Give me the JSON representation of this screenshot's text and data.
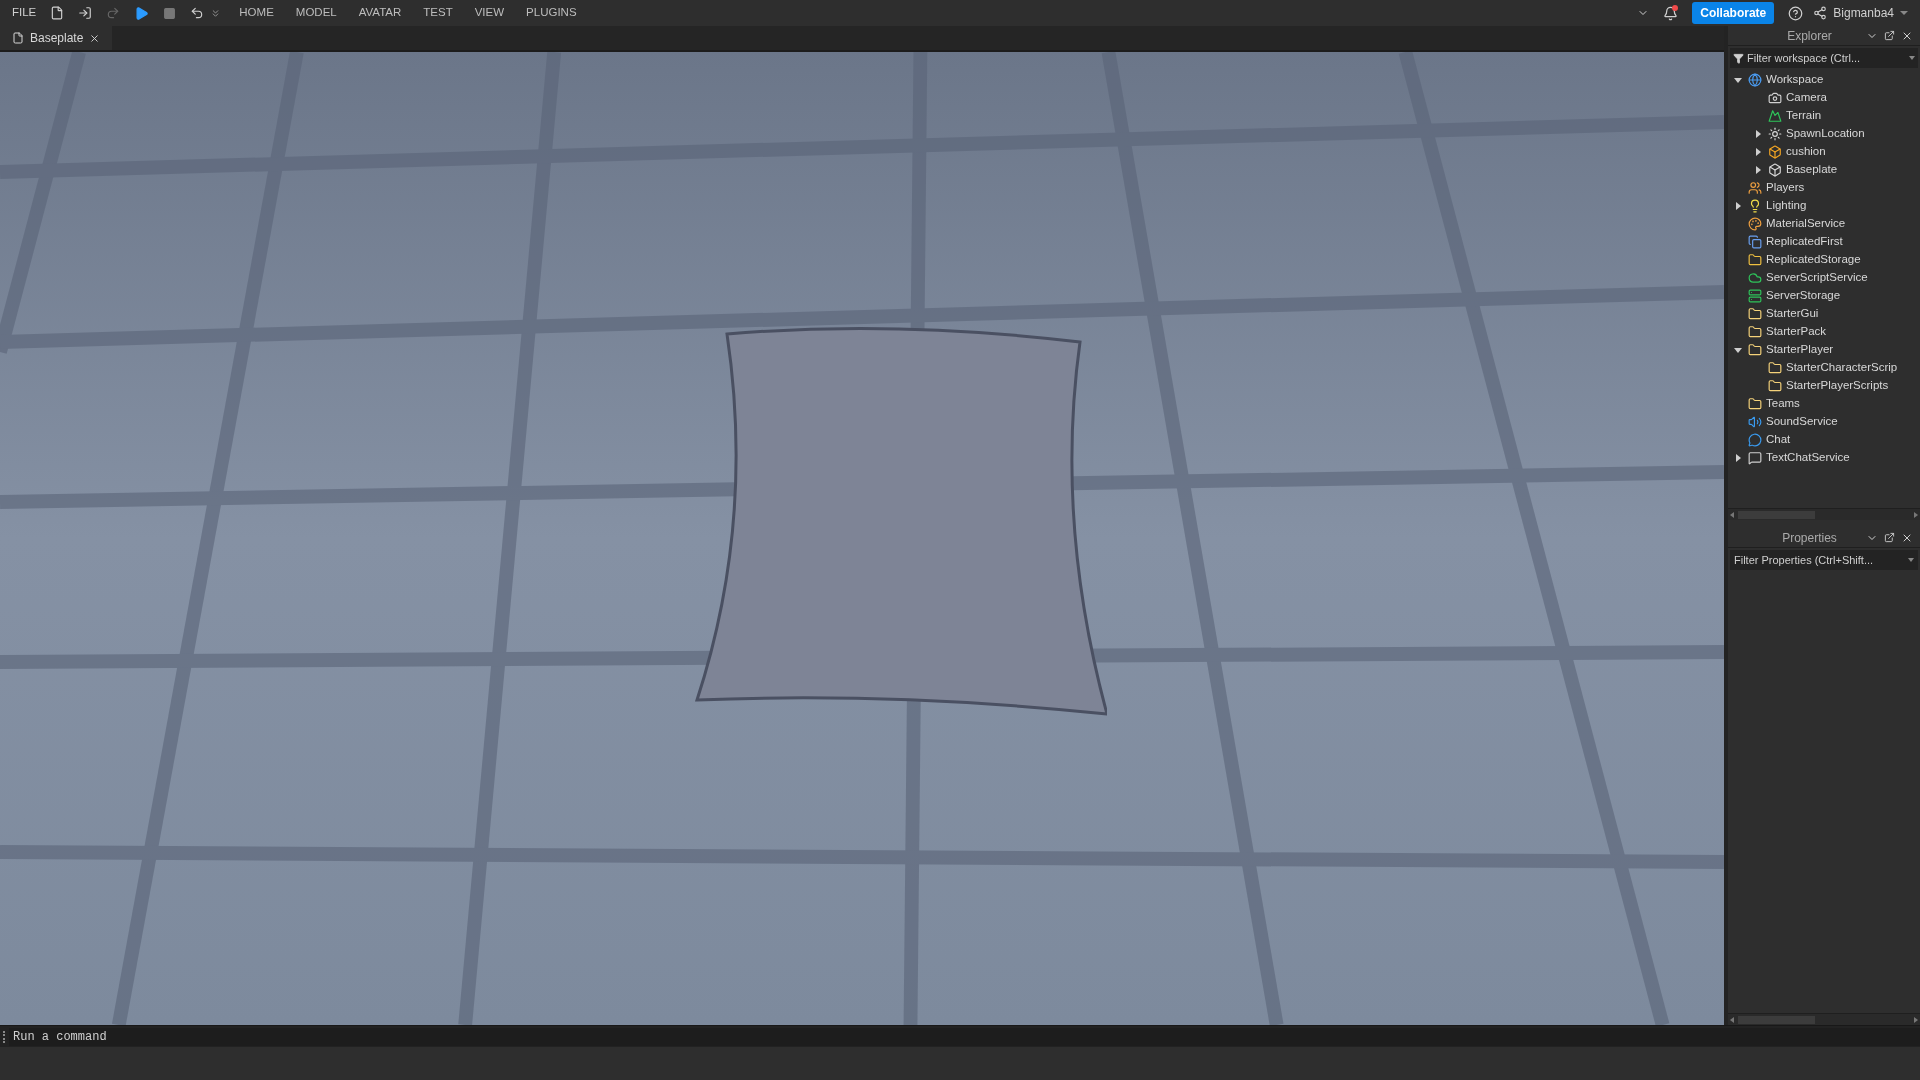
{
  "menu_bar": {
    "file": "FILE",
    "tabs": [
      {
        "label": "HOME",
        "selected": false
      },
      {
        "label": "MODEL",
        "selected": false
      },
      {
        "label": "AVATAR",
        "selected": false
      },
      {
        "label": "TEST",
        "selected": false
      },
      {
        "label": "VIEW",
        "selected": false
      },
      {
        "label": "PLUGINS",
        "selected": false
      }
    ],
    "collaborate": "Collaborate",
    "user": "Bigmanba4",
    "notification": true
  },
  "document_tabs": [
    {
      "label": "Baseplate",
      "selected": true
    }
  ],
  "explorer": {
    "title": "Explorer",
    "filter": {
      "placeholder": "Filter workspace (Ctrl..."
    },
    "items": [
      {
        "name": "Workspace",
        "kind": "workspace",
        "expanded": true,
        "children": [
          {
            "name": "Camera",
            "kind": "camera"
          },
          {
            "name": "Terrain",
            "kind": "terrain"
          },
          {
            "name": "SpawnLocation",
            "kind": "spawn",
            "expanded": false
          },
          {
            "name": "cushion",
            "kind": "model",
            "expanded": false
          },
          {
            "name": "Baseplate",
            "kind": "part",
            "expanded": false
          }
        ]
      },
      {
        "name": "Players",
        "kind": "players"
      },
      {
        "name": "Lighting",
        "kind": "lighting",
        "expanded": false
      },
      {
        "name": "MaterialService",
        "kind": "material"
      },
      {
        "name": "ReplicatedFirst",
        "kind": "replicatedfirst"
      },
      {
        "name": "ReplicatedStorage",
        "kind": "replicatedstorage"
      },
      {
        "name": "ServerScriptService",
        "kind": "serverscript"
      },
      {
        "name": "ServerStorage",
        "kind": "serverstorage"
      },
      {
        "name": "StarterGui",
        "kind": "folder"
      },
      {
        "name": "StarterPack",
        "kind": "folder"
      },
      {
        "name": "StarterPlayer",
        "kind": "folder",
        "expanded": true,
        "children": [
          {
            "name": "StarterCharacterScrip",
            "kind": "folder"
          },
          {
            "name": "StarterPlayerScripts",
            "kind": "folder"
          }
        ]
      },
      {
        "name": "Teams",
        "kind": "folder"
      },
      {
        "name": "SoundService",
        "kind": "sound"
      },
      {
        "name": "Chat",
        "kind": "chat"
      },
      {
        "name": "TextChatService",
        "kind": "textchat",
        "expanded": false
      }
    ]
  },
  "properties": {
    "title": "Properties",
    "filter": {
      "placeholder": "Filter Properties (Ctrl+Shift..."
    }
  },
  "command_bar": {
    "placeholder": "Run a command"
  }
}
